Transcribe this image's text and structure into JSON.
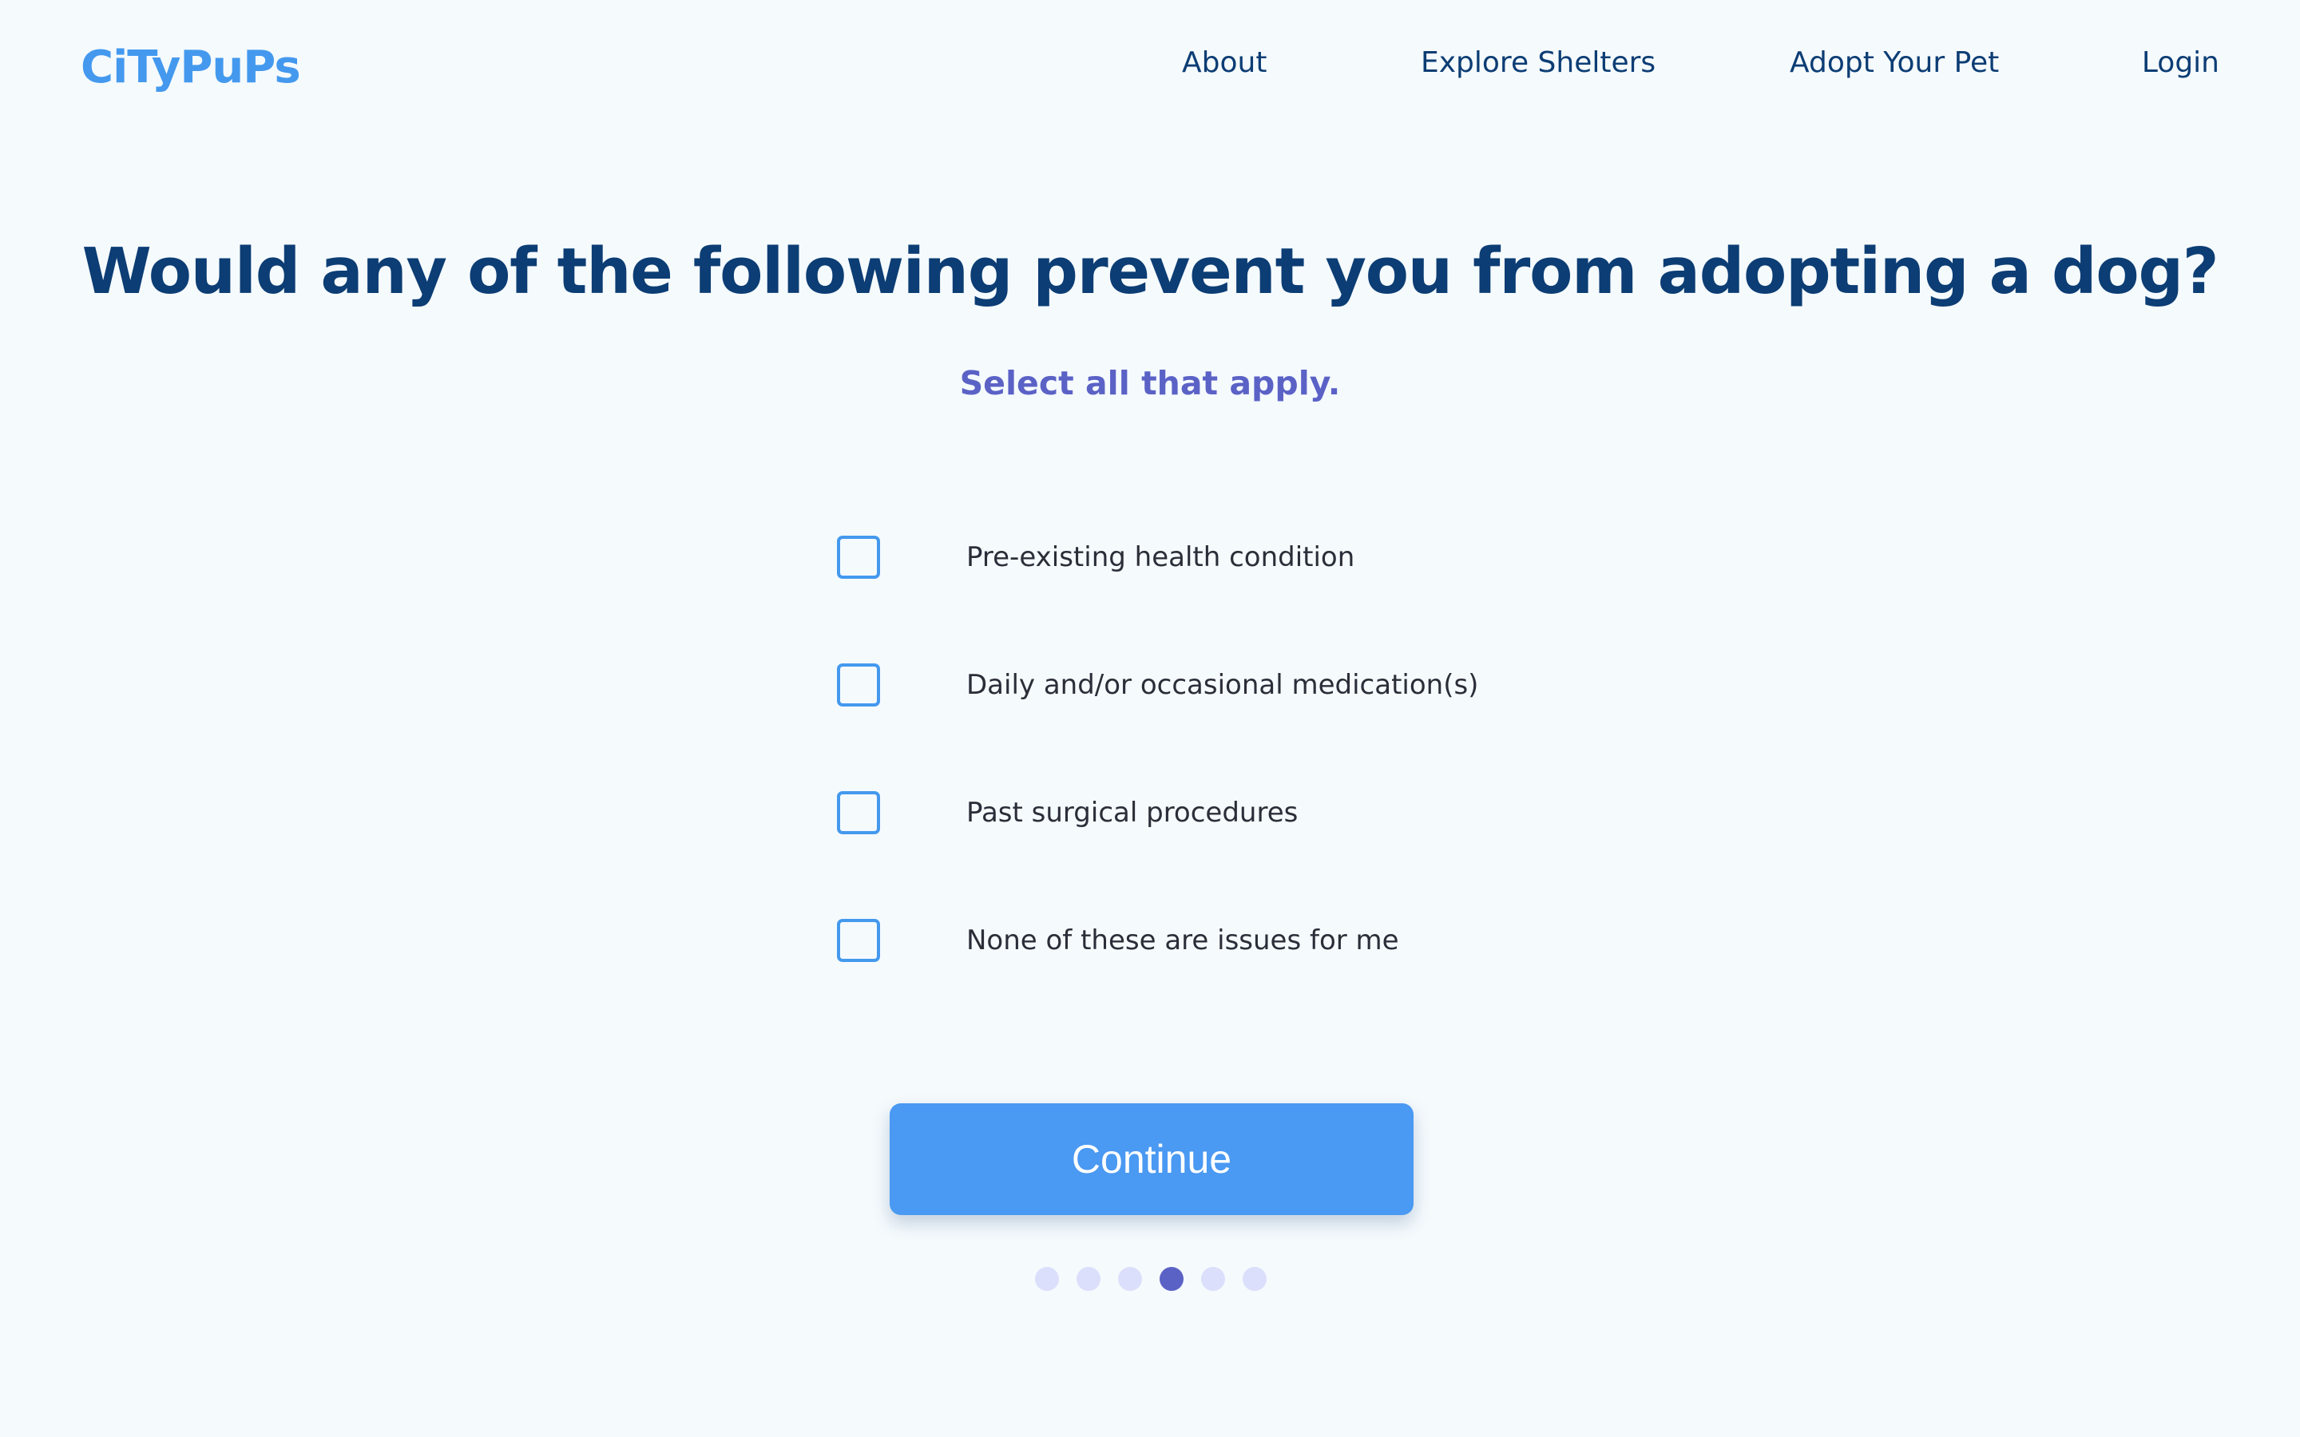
{
  "brand": {
    "logo": "CiTyPuPs"
  },
  "nav": {
    "about": "About",
    "explore": "Explore Shelters",
    "adopt": "Adopt Your Pet",
    "login": "Login"
  },
  "question": {
    "title": "Would any of the following prevent you from adopting a dog?",
    "subtitle": "Select all that apply."
  },
  "options": [
    {
      "label": "Pre-existing health condition",
      "checked": false
    },
    {
      "label": "Daily and/or occasional medication(s)",
      "checked": false
    },
    {
      "label": "Past surgical procedures",
      "checked": false
    },
    {
      "label": "None of these are issues for me",
      "checked": false
    }
  ],
  "actions": {
    "continue_label": "Continue"
  },
  "progress": {
    "total_steps": 6,
    "current_step": 4
  },
  "colors": {
    "background": "#f5fafd",
    "brand": "#4499ee",
    "heading": "#0c3d74",
    "accent": "#5b62c6",
    "button": "#4a99f2",
    "dot_inactive": "#dcdffb"
  }
}
